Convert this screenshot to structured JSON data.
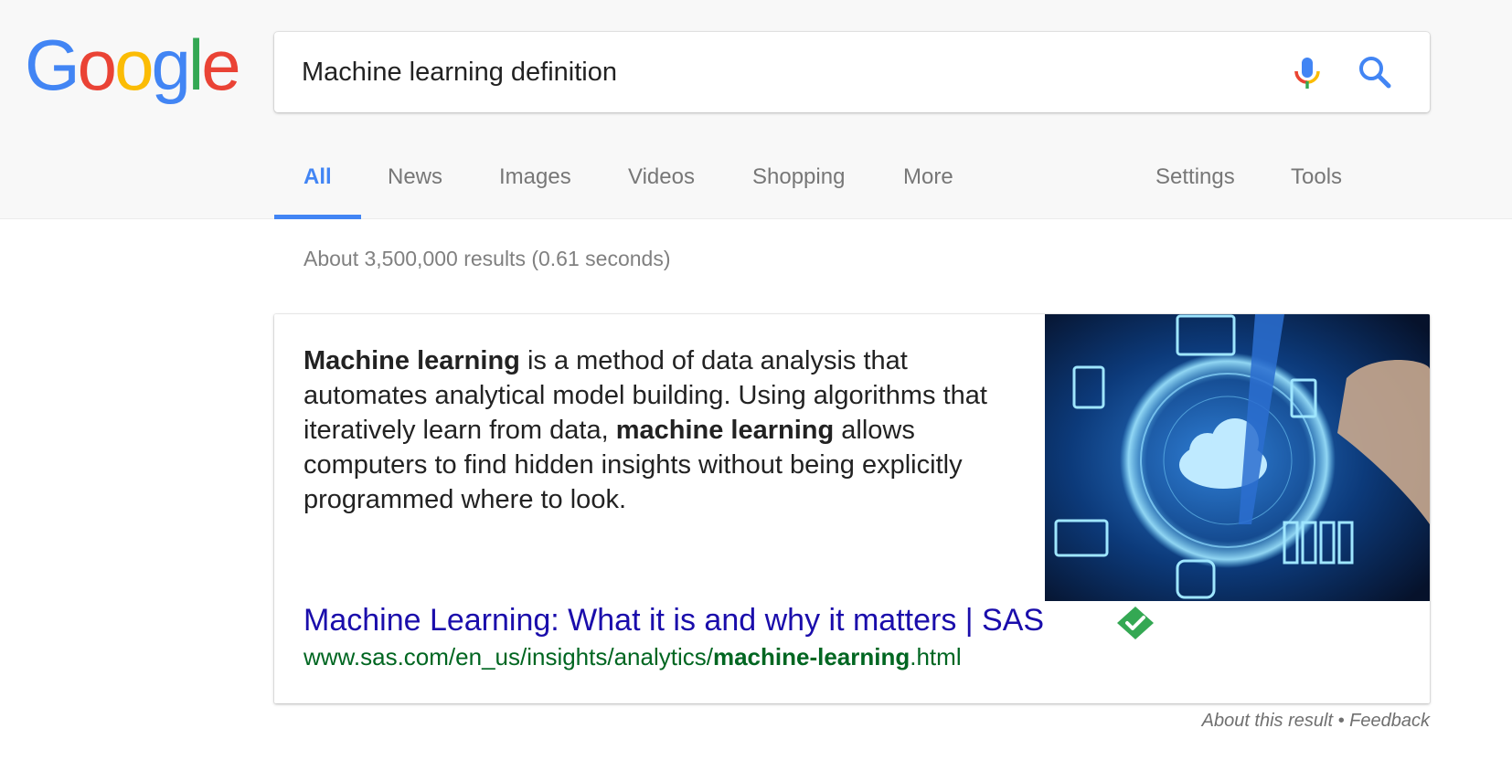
{
  "logo": {
    "letters": [
      "G",
      "o",
      "o",
      "g",
      "l",
      "e"
    ],
    "colors": [
      "#4285f4",
      "#ea4335",
      "#fbbc05",
      "#4285f4",
      "#34a853",
      "#ea4335"
    ]
  },
  "search": {
    "query": "Machine learning definition",
    "mic_icon": "microphone-icon",
    "search_icon": "search-icon"
  },
  "tabs": [
    {
      "label": "All",
      "active": true
    },
    {
      "label": "News"
    },
    {
      "label": "Images"
    },
    {
      "label": "Videos"
    },
    {
      "label": "Shopping"
    },
    {
      "label": "More"
    },
    {
      "label": "Settings"
    },
    {
      "label": "Tools"
    }
  ],
  "stats": "About 3,500,000 results (0.61 seconds)",
  "featured": {
    "snippet_parts": [
      {
        "text": "Machine learning",
        "bold": true
      },
      {
        "text": " is a method of data analysis that automates analytical model building. Using algorithms that iteratively learn from data, ",
        "bold": false
      },
      {
        "text": "machine learning",
        "bold": true
      },
      {
        "text": " allows computers to find hidden insights without being explicitly programmed where to look.",
        "bold": false
      }
    ],
    "title": "Machine Learning: What it is and why it matters | SAS",
    "url_prefix": "www.sas.com/en_us/insights/analytics/",
    "url_bold": "machine-learning",
    "url_suffix": ".html",
    "verified_icon": "verified-check-icon"
  },
  "footer": {
    "about": "About this result",
    "separator": " • ",
    "feedback": "Feedback"
  },
  "colors": {
    "accent": "#4285f4",
    "link": "#1a0dab",
    "url": "#006621",
    "verified": "#34a853"
  }
}
